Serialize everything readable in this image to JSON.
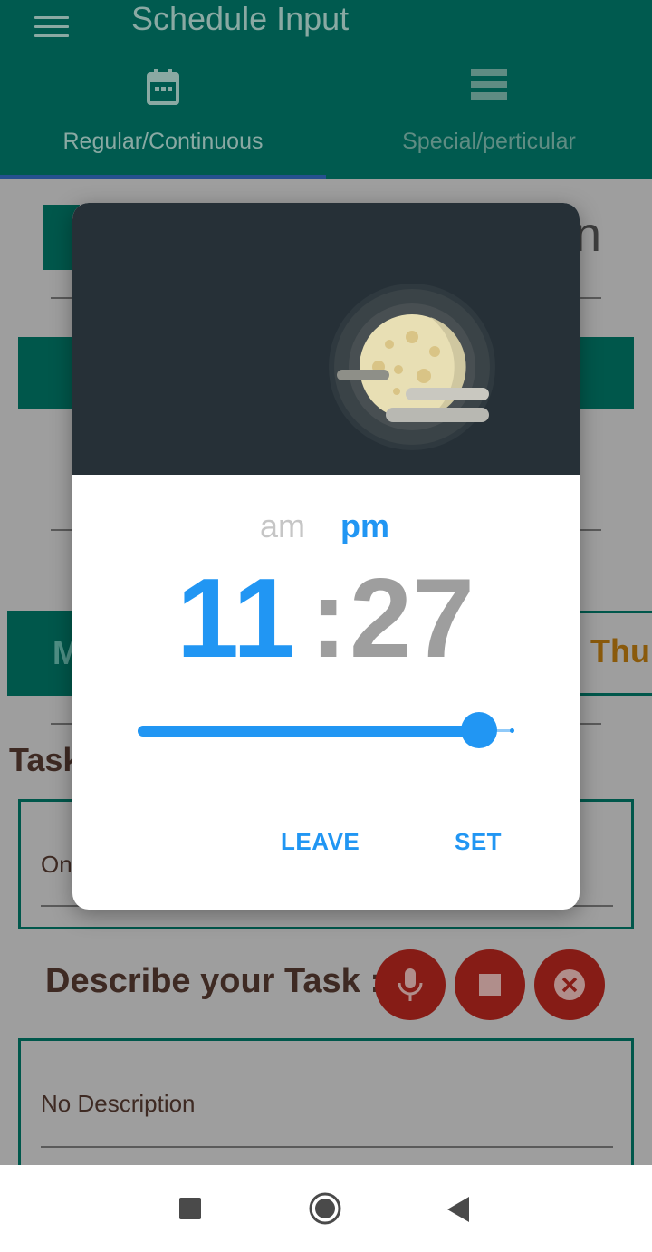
{
  "appbar": {
    "title": "Schedule Input",
    "tabs": [
      {
        "label": "Regular/Continuous",
        "icon": "calendar-icon",
        "selected": true
      },
      {
        "label": "Special/perticular",
        "icon": "list-icon",
        "selected": false
      }
    ]
  },
  "background": {
    "thu_partial": "Thu",
    "m_partial": "M",
    "n_partial": "n",
    "task_partial": "Task",
    "task_name_partial": "On",
    "describe_label": "Describe your Task :",
    "description_value": "No Description",
    "voice_buttons": [
      "mic-icon",
      "stop-icon",
      "cancel-icon"
    ],
    "colors": {
      "primary": "#00574b",
      "record": "#861c16"
    }
  },
  "time_picker": {
    "am_label": "am",
    "pm_label": "pm",
    "selected_period": "pm",
    "hour": "11",
    "separator": ":",
    "minute": "27",
    "slider_fraction": 0.91,
    "leave_label": "LEAVE",
    "set_label": "SET",
    "header_icon": "moon-icon",
    "accent_color": "#2196f3",
    "header_color": "#263037"
  },
  "navbar": {
    "buttons": [
      "recents-icon",
      "home-icon",
      "back-icon"
    ]
  }
}
